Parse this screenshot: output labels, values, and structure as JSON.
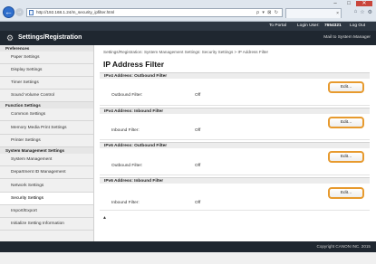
{
  "browser": {
    "url": "http://192.168.1.24/m_security_ipfilter.html",
    "tab_title": "",
    "controls": {
      "minimize": "–",
      "maximize": "□",
      "close": "✕"
    },
    "addr_tools": "ρ ▾ ⊠ ↻",
    "right_icons": [
      "⌂",
      "☆",
      "⚙"
    ]
  },
  "topbar": {
    "to_portal": "To Portal",
    "login_user": "Login User:",
    "user_id": "7654321",
    "logout": "Log Out"
  },
  "header": {
    "title": "Settings/Registration",
    "mail_to_admin": "Mail to System Manager"
  },
  "sidebar": {
    "sections": [
      {
        "title": "Preferences",
        "items": [
          "Paper Settings",
          "Display Settings",
          "Timer Settings",
          "Sound Volume Control"
        ]
      },
      {
        "title": "Function Settings",
        "items": [
          "Common Settings",
          "Memory Media Print Settings",
          "Printer Settings"
        ]
      },
      {
        "title": "System Management Settings",
        "items": [
          "System Management",
          "Department ID Management",
          "Network Settings",
          "Security Settings",
          "Import/Export",
          "Initialize Setting Information"
        ]
      }
    ],
    "active": "Security Settings"
  },
  "main": {
    "breadcrumb": "Settings/Registration: System Management Settings: Security Settings > IP Address Filter",
    "title": "IP Address Filter",
    "sections": [
      {
        "heading": "IPv4 Address: Outbound Filter",
        "field": "Outbound Filter:",
        "value": "Off",
        "edit": "Edit..."
      },
      {
        "heading": "IPv4 Address: Inbound Filter",
        "field": "Inbound Filter:",
        "value": "Off",
        "edit": "Edit..."
      },
      {
        "heading": "IPv6 Address: Outbound Filter",
        "field": "Outbound Filter:",
        "value": "Off",
        "edit": "Edit..."
      },
      {
        "heading": "IPv6 Address: Inbound Filter",
        "field": "Inbound Filter:",
        "value": "Off",
        "edit": "Edit..."
      }
    ],
    "to_top": "▲"
  },
  "footer": {
    "copyright": "Copyright CANON INC. 2015"
  },
  "colors": {
    "accent_orange": "#e79a2e",
    "header_dark": "#1f2730",
    "link_blue": "#2f6fcd"
  }
}
